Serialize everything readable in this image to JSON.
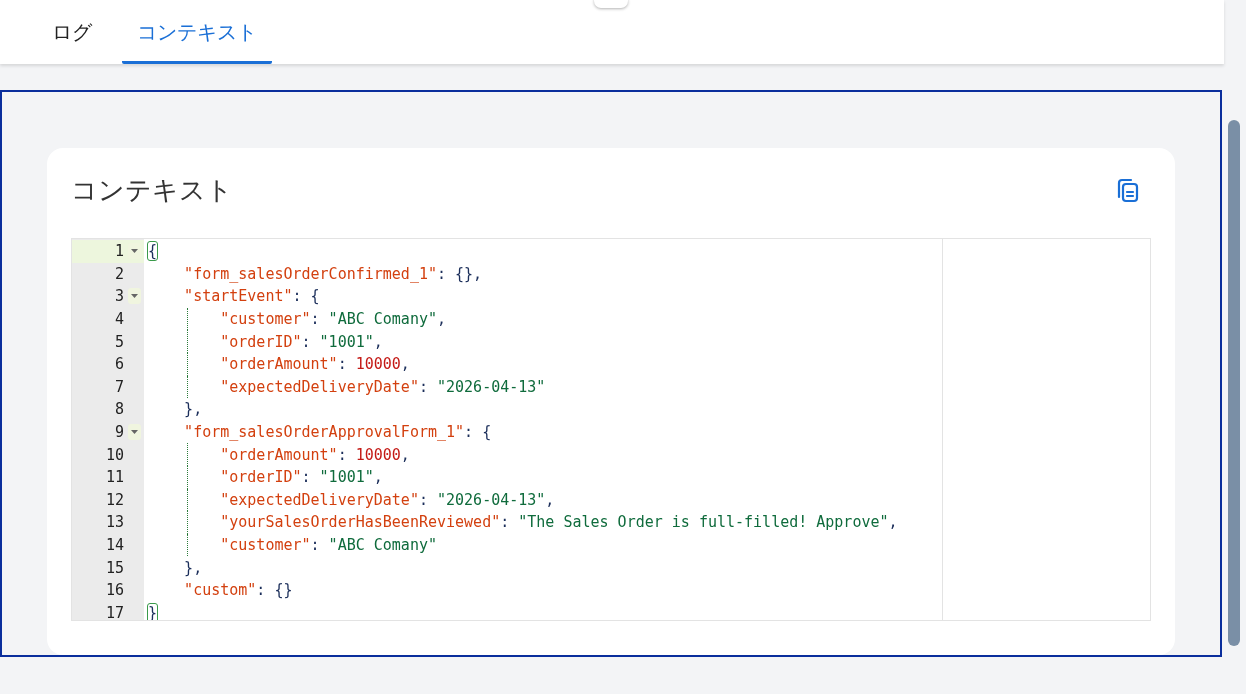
{
  "tabs": [
    {
      "label": "ログ",
      "selected": false
    },
    {
      "label": "コンテキスト",
      "selected": true
    }
  ],
  "card": {
    "title": "コンテキスト"
  },
  "editor": {
    "lines": [
      {
        "number": "1",
        "fold": true,
        "active": true,
        "tokens": [
          {
            "kind": "bracket",
            "text": "{"
          }
        ],
        "children": [
          {
            "number": "2",
            "fold": false,
            "active": false,
            "tokens": [
              {
                "kind": "key",
                "text": "\"form_salesOrderConfirmed_1\""
              },
              {
                "kind": "punct",
                "text": ": {},"
              }
            ]
          },
          {
            "number": "3",
            "fold": true,
            "active": false,
            "tokens": [
              {
                "kind": "key",
                "text": "\"startEvent\""
              },
              {
                "kind": "punct",
                "text": ": {"
              }
            ],
            "children": [
              {
                "number": "4",
                "fold": false,
                "active": false,
                "tokens": [
                  {
                    "kind": "key",
                    "text": "\"customer\""
                  },
                  {
                    "kind": "punct",
                    "text": ": "
                  },
                  {
                    "kind": "string",
                    "text": "\"ABC Comany\""
                  },
                  {
                    "kind": "punct",
                    "text": ","
                  }
                ]
              },
              {
                "number": "5",
                "fold": false,
                "active": false,
                "tokens": [
                  {
                    "kind": "key",
                    "text": "\"orderID\""
                  },
                  {
                    "kind": "punct",
                    "text": ": "
                  },
                  {
                    "kind": "string",
                    "text": "\"1001\""
                  },
                  {
                    "kind": "punct",
                    "text": ","
                  }
                ]
              },
              {
                "number": "6",
                "fold": false,
                "active": false,
                "tokens": [
                  {
                    "kind": "key",
                    "text": "\"orderAmount\""
                  },
                  {
                    "kind": "punct",
                    "text": ": "
                  },
                  {
                    "kind": "number",
                    "text": "10000"
                  },
                  {
                    "kind": "punct",
                    "text": ","
                  }
                ]
              },
              {
                "number": "7",
                "fold": false,
                "active": false,
                "tokens": [
                  {
                    "kind": "key",
                    "text": "\"expectedDeliveryDate\""
                  },
                  {
                    "kind": "punct",
                    "text": ": "
                  },
                  {
                    "kind": "string",
                    "text": "\"2026-04-13\""
                  }
                ]
              }
            ]
          },
          {
            "number": "8",
            "fold": false,
            "active": false,
            "tokens": [
              {
                "kind": "punct",
                "text": "},"
              }
            ]
          },
          {
            "number": "9",
            "fold": true,
            "active": false,
            "tokens": [
              {
                "kind": "key",
                "text": "\"form_salesOrderApprovalForm_1\""
              },
              {
                "kind": "punct",
                "text": ": {"
              }
            ],
            "children": [
              {
                "number": "10",
                "fold": false,
                "active": false,
                "tokens": [
                  {
                    "kind": "key",
                    "text": "\"orderAmount\""
                  },
                  {
                    "kind": "punct",
                    "text": ": "
                  },
                  {
                    "kind": "number",
                    "text": "10000"
                  },
                  {
                    "kind": "punct",
                    "text": ","
                  }
                ]
              },
              {
                "number": "11",
                "fold": false,
                "active": false,
                "tokens": [
                  {
                    "kind": "key",
                    "text": "\"orderID\""
                  },
                  {
                    "kind": "punct",
                    "text": ": "
                  },
                  {
                    "kind": "string",
                    "text": "\"1001\""
                  },
                  {
                    "kind": "punct",
                    "text": ","
                  }
                ]
              },
              {
                "number": "12",
                "fold": false,
                "active": false,
                "tokens": [
                  {
                    "kind": "key",
                    "text": "\"expectedDeliveryDate\""
                  },
                  {
                    "kind": "punct",
                    "text": ": "
                  },
                  {
                    "kind": "string",
                    "text": "\"2026-04-13\""
                  },
                  {
                    "kind": "punct",
                    "text": ","
                  }
                ]
              },
              {
                "number": "13",
                "fold": false,
                "active": false,
                "tokens": [
                  {
                    "kind": "key",
                    "text": "\"yourSalesOrderHasBeenReviewed\""
                  },
                  {
                    "kind": "punct",
                    "text": ": "
                  },
                  {
                    "kind": "string",
                    "text": "\"The Sales Order is full-filled! Approve\""
                  },
                  {
                    "kind": "punct",
                    "text": ","
                  }
                ]
              },
              {
                "number": "14",
                "fold": false,
                "active": false,
                "tokens": [
                  {
                    "kind": "key",
                    "text": "\"customer\""
                  },
                  {
                    "kind": "punct",
                    "text": ": "
                  },
                  {
                    "kind": "string",
                    "text": "\"ABC Comany\""
                  }
                ]
              }
            ]
          },
          {
            "number": "15",
            "fold": false,
            "active": false,
            "tokens": [
              {
                "kind": "punct",
                "text": "},"
              }
            ]
          },
          {
            "number": "16",
            "fold": false,
            "active": false,
            "tokens": [
              {
                "kind": "key",
                "text": "\"custom\""
              },
              {
                "kind": "punct",
                "text": ": {}"
              }
            ]
          }
        ]
      },
      {
        "number": "17",
        "fold": false,
        "active": false,
        "tokens": [
          {
            "kind": "bracket",
            "text": "}"
          }
        ]
      }
    ]
  }
}
